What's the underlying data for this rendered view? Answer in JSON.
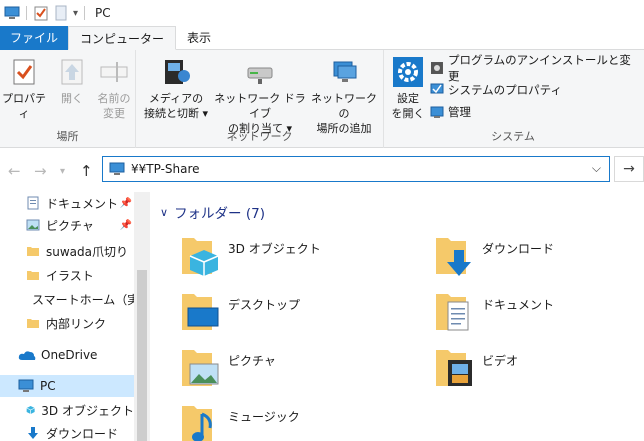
{
  "window": {
    "title": "PC"
  },
  "tabs": [
    "ファイル",
    "コンピューター",
    "表示"
  ],
  "ribbon": {
    "location_group": {
      "label": "場所",
      "properties": "プロパティ",
      "open": "開く",
      "rename_line1": "名前の",
      "rename_line2": "変更"
    },
    "network_group": {
      "label": "ネットワーク",
      "media_line1": "メディアの",
      "media_line2": "接続と切断 ▾",
      "map_line1": "ネットワーク ドライブ",
      "map_line2": "の割り当て ▾",
      "addloc_line1": "ネットワークの",
      "addloc_line2": "場所の追加"
    },
    "system_group": {
      "label": "システム",
      "settings_line1": "設定",
      "settings_line2": "を開く",
      "uninstall": "プログラムのアンインストールと変更",
      "sys_props": "システムのプロパティ",
      "manage": "管理"
    }
  },
  "address": {
    "path": "¥¥TP-Share"
  },
  "nav": {
    "items": [
      "ドキュメント",
      "ピクチャ",
      "suwada爪切り",
      "イラスト",
      "スマートホーム（実",
      "内部リンク",
      "OneDrive",
      "PC",
      "3D オブジェクト",
      "ダウンロード"
    ]
  },
  "content": {
    "section": "フォルダー (7)",
    "folders": [
      "3D オブジェクト",
      "ダウンロード",
      "デスクトップ",
      "ドキュメント",
      "ピクチャ",
      "ビデオ",
      "ミュージック"
    ]
  },
  "colors": {
    "accent": "#1979ca",
    "folder": "#f5c96a",
    "header": "#1e3287",
    "selected": "#cce8ff"
  }
}
